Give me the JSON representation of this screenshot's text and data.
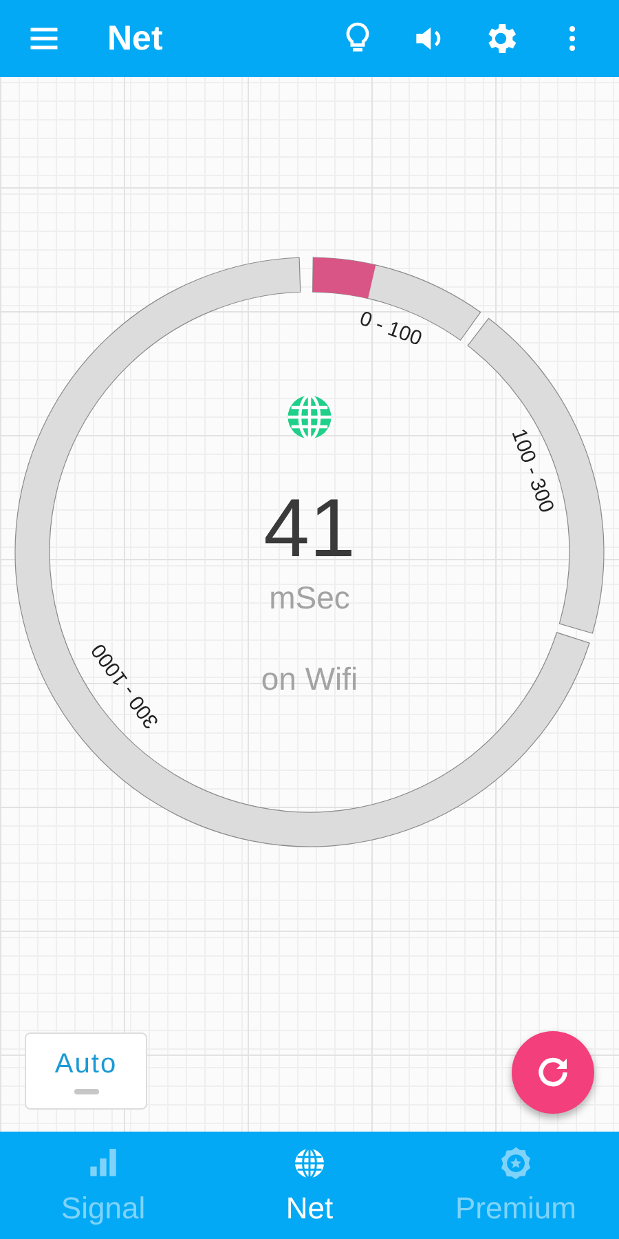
{
  "app_bar": {
    "title": "Net"
  },
  "gauge": {
    "value": "41",
    "unit": "mSec",
    "connection": "on Wifi",
    "segments": [
      {
        "label": "0 - 100"
      },
      {
        "label": "100 - 300"
      },
      {
        "label": "300 - 1000"
      }
    ]
  },
  "mode_button": {
    "label": "Auto"
  },
  "bottom_nav": [
    {
      "label": "Signal",
      "selected": false
    },
    {
      "label": "Net",
      "selected": true
    },
    {
      "label": "Premium",
      "selected": false
    }
  ]
}
